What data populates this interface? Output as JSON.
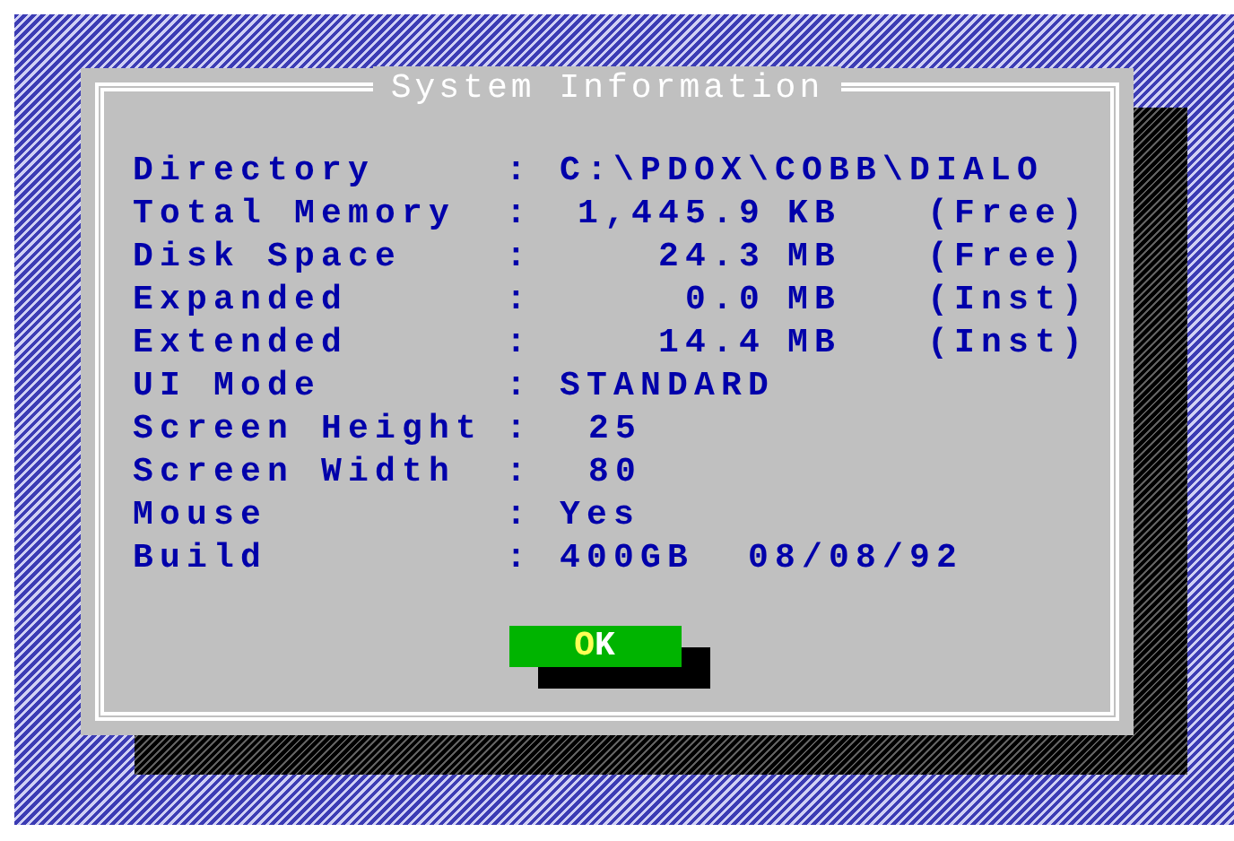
{
  "dialog": {
    "title": "System Information",
    "rows": [
      {
        "kind": "text",
        "label": "Directory",
        "separator": ":",
        "value": "C:\\PDOX\\COBB\\DIALO"
      },
      {
        "kind": "measure",
        "label": "Total Memory",
        "separator": ":",
        "amount": "1,445.9",
        "unit": "KB",
        "note": "(Free)"
      },
      {
        "kind": "measure",
        "label": "Disk Space",
        "separator": ":",
        "amount": "24.3",
        "unit": "MB",
        "note": "(Free)"
      },
      {
        "kind": "measure",
        "label": "Expanded",
        "separator": ":",
        "amount": "0.0",
        "unit": "MB",
        "note": "(Inst)"
      },
      {
        "kind": "measure",
        "label": "Extended",
        "separator": ":",
        "amount": "14.4",
        "unit": "MB",
        "note": "(Inst)"
      },
      {
        "kind": "text",
        "label": "UI Mode",
        "separator": ":",
        "value": "STANDARD"
      },
      {
        "kind": "number",
        "label": "Screen Height",
        "separator": ":",
        "value": "25"
      },
      {
        "kind": "number",
        "label": "Screen Width",
        "separator": ":",
        "value": "80"
      },
      {
        "kind": "text",
        "label": "Mouse",
        "separator": ":",
        "value": "Yes"
      },
      {
        "kind": "text",
        "label": "Build",
        "separator": ":",
        "value": "400GB  08/08/92"
      }
    ],
    "button": {
      "hotkey": "O",
      "rest": "K"
    }
  }
}
